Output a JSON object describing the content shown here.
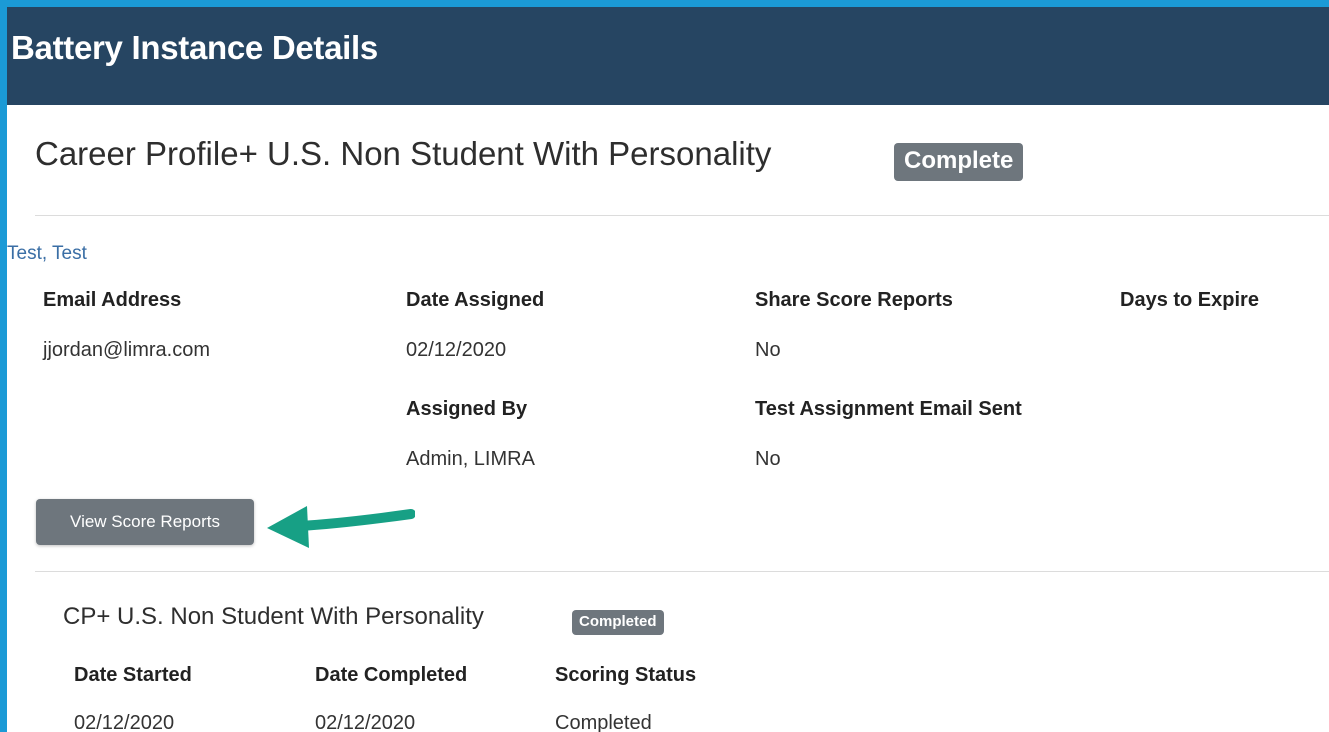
{
  "header": {
    "title": "Battery Instance Details"
  },
  "battery": {
    "name": "Career Profile+ U.S. Non Student With Personality",
    "status": "Complete"
  },
  "candidate": {
    "name": "Test, Test"
  },
  "details": {
    "email_label": "Email Address",
    "email_value": "jjordan@limra.com",
    "date_assigned_label": "Date Assigned",
    "date_assigned_value": "02/12/2020",
    "share_label": "Share Score Reports",
    "share_value": "No",
    "days_label": "Days to Expire",
    "assigned_by_label": "Assigned By",
    "assigned_by_value": "Admin, LIMRA",
    "email_sent_label": "Test Assignment Email Sent",
    "email_sent_value": "No"
  },
  "actions": {
    "view_score_reports": "View Score Reports"
  },
  "annotation": {
    "arrow_color": "#17a085"
  },
  "test": {
    "name": "CP+ U.S. Non Student With Personality",
    "status": "Completed",
    "date_started_label": "Date Started",
    "date_started_value": "02/12/2020",
    "date_completed_label": "Date Completed",
    "date_completed_value": "02/12/2020",
    "scoring_status_label": "Scoring Status",
    "scoring_status_value": "Completed"
  },
  "colors": {
    "header_bg": "#264562",
    "frame_border": "#1b9ad6",
    "badge_bg": "#6e767d",
    "button_bg": "#6e767d",
    "link": "#3a6ea5"
  }
}
